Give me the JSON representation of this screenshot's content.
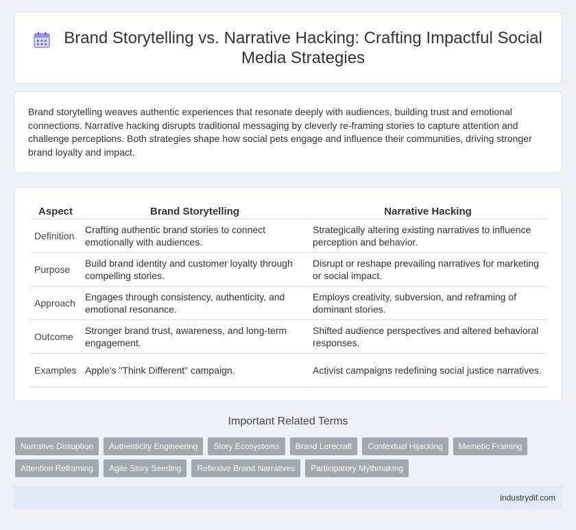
{
  "header": {
    "icon": "calendar-icon",
    "title": "Brand Storytelling vs. Narrative Hacking: Crafting Impactful Social Media Strategies"
  },
  "intro": "Brand storytelling weaves authentic experiences that resonate deeply with audiences, building trust and emotional connections. Narrative hacking disrupts traditional messaging by cleverly re-framing stories to capture attention and challenge perceptions. Both strategies shape how social pets engage and influence their communities, driving stronger brand loyalty and impact.",
  "table": {
    "headers": [
      "Aspect",
      "Brand Storytelling",
      "Narrative Hacking"
    ],
    "rows": [
      [
        "Definition",
        "Crafting authentic brand stories to connect emotionally with audiences.",
        "Strategically altering existing narratives to influence perception and behavior."
      ],
      [
        "Purpose",
        "Build brand identity and customer loyalty through compelling stories.",
        "Disrupt or reshape prevailing narratives for marketing or social impact."
      ],
      [
        "Approach",
        "Engages through consistency, authenticity, and emotional resonance.",
        "Employs creativity, subversion, and reframing of dominant stories."
      ],
      [
        "Outcome",
        "Stronger brand trust, awareness, and long-term engagement.",
        "Shifted audience perspectives and altered behavioral responses."
      ],
      [
        "Examples",
        "Apple's \"Think Different\" campaign.",
        "Activist campaigns redefining social justice narratives."
      ]
    ]
  },
  "related": {
    "title": "Important Related Terms",
    "tags": [
      "Narrative Disruption",
      "Authenticity Engineering",
      "Story Ecosystems",
      "Brand Lorecraft",
      "Contextual Hijacking",
      "Memetic Framing",
      "Attention Reframing",
      "Agile Story Seeding",
      "Reflexive Brand Narratives",
      "Participatory Mythmaking"
    ]
  },
  "footer": "industrydif.com",
  "colors": {
    "background": "#eef2f8",
    "tag": "#a3a7ae",
    "footer": "#e3e9f5",
    "icon": "#7b6fd6"
  }
}
